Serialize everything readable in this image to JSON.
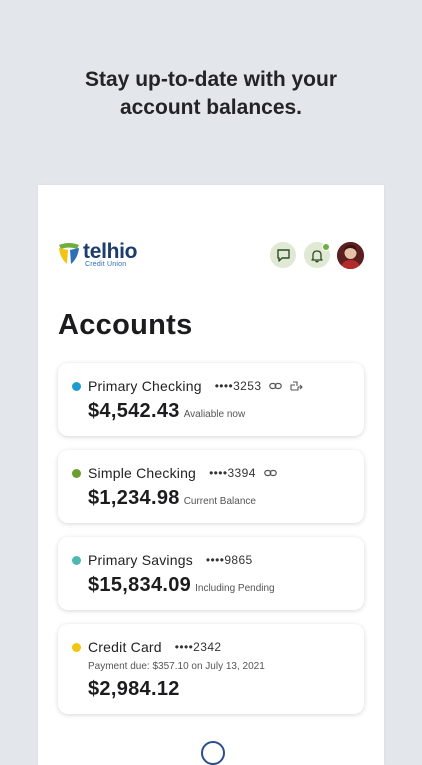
{
  "headline": {
    "line1": "Stay up-to-date with your",
    "line2": "account balances."
  },
  "brand": {
    "name": "telhio",
    "subtitle": "Credit Union",
    "colors": {
      "navy": "#1d3c6e",
      "green": "#6fae3c",
      "yellow": "#f3c316",
      "blue": "#2b6fb6"
    }
  },
  "header": {
    "chat_icon": "chat-bubble-icon",
    "bell_icon": "bell-icon",
    "has_notification": true
  },
  "page": {
    "title": "Accounts"
  },
  "accounts": [
    {
      "name": "Primary Checking",
      "number": "••••3253",
      "amount": "$4,542.43",
      "note": "Avaliable now",
      "color": "#1f9bd1",
      "icons": [
        "link-icon",
        "transfer-icon"
      ]
    },
    {
      "name": "Simple Checking",
      "number": "••••3394",
      "amount": "$1,234.98",
      "note": "Current Balance",
      "color": "#6b9e2e",
      "icons": [
        "link-icon"
      ]
    },
    {
      "name": "Primary Savings",
      "number": "••••9865",
      "amount": "$15,834.09",
      "note": "Including Pending",
      "color": "#4fb8b0",
      "icons": []
    },
    {
      "name": "Credit Card",
      "number": "••••2342",
      "amount": "$2,984.12",
      "note": "",
      "due": "Payment due: $357.10 on July 13, 2021",
      "color": "#f2c60f",
      "icons": []
    }
  ]
}
